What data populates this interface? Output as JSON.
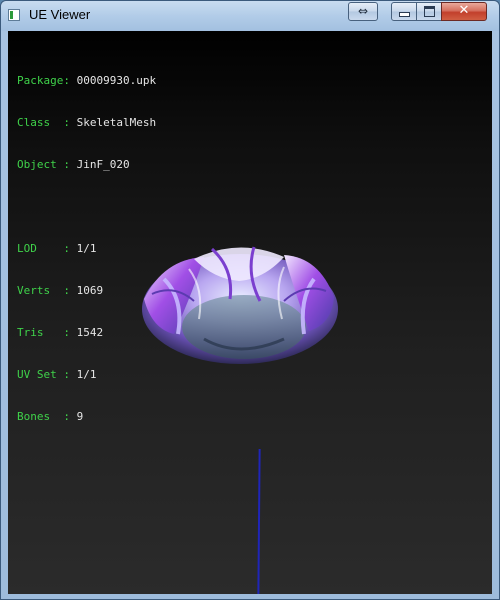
{
  "window": {
    "title": "UE Viewer",
    "swap_label": "⇔",
    "close_label": "✕"
  },
  "info": {
    "package": {
      "label": "Package:",
      "value": "00009930.upk"
    },
    "class": {
      "label": "Class  :",
      "value": "SkeletalMesh"
    },
    "object": {
      "label": "Object :",
      "value": "JinF_020"
    },
    "lod": {
      "label": "LOD    :",
      "value": "1/1"
    },
    "verts": {
      "label": "Verts  :",
      "value": "1069"
    },
    "tris": {
      "label": "Tris   :",
      "value": "1542"
    },
    "uvset": {
      "label": "UV Set :",
      "value": "1/1"
    },
    "bones": {
      "label": "Bones  :",
      "value": "9"
    }
  },
  "colors": {
    "label_green": "#3fd24a",
    "value_white": "#e6e6e6",
    "axis_blue": "#1f25b8",
    "mesh_purple": "#9a5ce0"
  }
}
